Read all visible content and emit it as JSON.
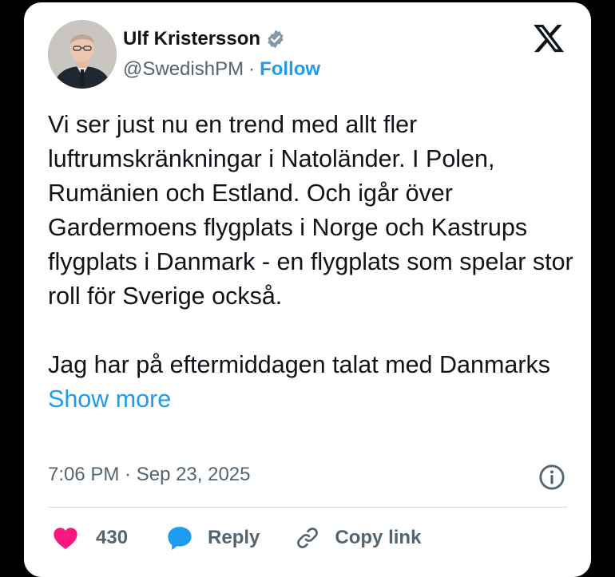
{
  "author": {
    "name": "Ulf Kristersson",
    "handle": "@SwedishPM",
    "separator": "·",
    "follow_label": "Follow",
    "verified": true
  },
  "tweet": {
    "paragraph1": "Vi ser just nu en trend med allt fler luftrumskränkningar i Natoländer. I Polen, Rumänien och Estland. Och igår över Gardermoens flygplats i Norge och Kastrups flygplats i Danmark - en flygplats som spelar stor roll för Sverige också.",
    "paragraph2": "Jag har på eftermiddagen talat med Danmarks",
    "show_more_label": "Show more"
  },
  "meta": {
    "timestamp": "7:06 PM · Sep 23, 2025"
  },
  "actions": {
    "like_count": "430",
    "reply_label": "Reply",
    "copy_link_label": "Copy link"
  },
  "colors": {
    "accent": "#1d9bf0",
    "like": "#f91880",
    "text": "#0f1419",
    "muted": "#536471",
    "background": "#000000",
    "card": "#ffffff"
  },
  "icons": [
    "verified-badge-icon",
    "x-logo-icon",
    "info-icon",
    "heart-icon",
    "reply-icon",
    "link-icon"
  ]
}
